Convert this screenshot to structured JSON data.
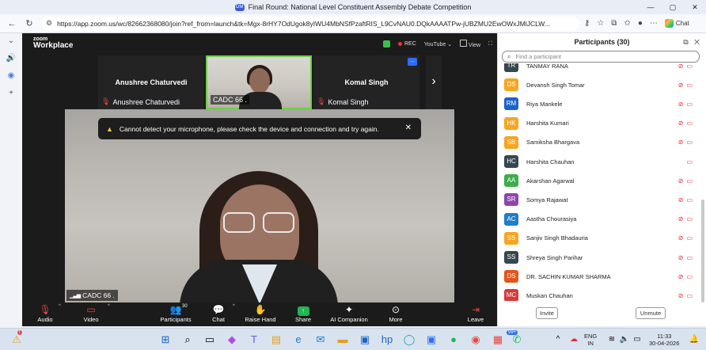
{
  "browser": {
    "tab_title": "Final Round:  National Level Constituent Assembly Debate Competition",
    "tab_logo": "DM",
    "url": "https://app.zoom.us/wc/82662368080/join?ref_from=launch&tk=Mgx-8rHY7OdUgok8yIWU4MbNSfPzaftRIS_L9CvNAU0.DQkAAAATPw-jUBZMU2EwOWxJMlJCLW...",
    "chat_label": "Chat"
  },
  "zoom": {
    "logo_line1": "zoom",
    "logo_line2": "Workplace",
    "rec_label": "REC",
    "youtube_label": "YouTube",
    "view_label": "View",
    "tiles": [
      {
        "big_name": "Anushree Chaturvedi",
        "label": "Anushree Chaturvedi"
      },
      {
        "big_name": "",
        "label": "CADC 66 ."
      },
      {
        "big_name": "Komal Singh",
        "label": "Komal Singh"
      }
    ],
    "more_label": "...",
    "toast": "Cannot detect your microphone, please check the device and connection and try again.",
    "main_label": "CADC 66 .",
    "toolbar": {
      "audio": "Audio",
      "video": "Video",
      "participants": "Participants",
      "participants_count": "30",
      "chat": "Chat",
      "raise_hand": "Raise Hand",
      "share": "Share",
      "ai_companion": "AI Companion",
      "more": "More",
      "leave": "Leave"
    }
  },
  "participants": {
    "title": "Participants (30)",
    "search_placeholder": "Find a participant",
    "list": [
      {
        "initials": "TR",
        "name": "TANMAY RANA",
        "color": "#37474f",
        "icons": "🎤📷"
      },
      {
        "initials": "DS",
        "name": "Devansh Singh Tomar",
        "color": "#f5a623",
        "icons": "🎤📷"
      },
      {
        "initials": "RM",
        "name": "Riya Mankele",
        "color": "#1e63c6",
        "icons": "🎤📷"
      },
      {
        "initials": "HK",
        "name": "Harshita Kumari",
        "color": "#f5a623",
        "icons": "🎤📷"
      },
      {
        "initials": "SB",
        "name": "Samiksha Bhargava",
        "color": "#f5a623",
        "icons": "🎤📷"
      },
      {
        "initials": "HC",
        "name": "Harshita Chauhan",
        "color": "#37474f",
        "icons": "📷"
      },
      {
        "initials": "AA",
        "name": "Akarshan Agarwal",
        "color": "#3cae4a",
        "icons": "🎤📷"
      },
      {
        "initials": "SR",
        "name": "Somya Rajawat",
        "color": "#8e44ad",
        "icons": "🎤📷"
      },
      {
        "initials": "AC",
        "name": "Aastha Chourasiya",
        "color": "#1e7fc6",
        "icons": "🎤📷"
      },
      {
        "initials": "SS",
        "name": "Sanjiv Singh Bhadauria",
        "color": "#f5a623",
        "icons": "🎤📷"
      },
      {
        "initials": "SS",
        "name": "Shreya Singh Parihar",
        "color": "#37474f",
        "icons": "🎤📷"
      },
      {
        "initials": "DS",
        "name": "DR. SACHIN KUMAR SHARMA",
        "color": "#e0561e",
        "icons": "🎤📷"
      },
      {
        "initials": "MC",
        "name": "Muskan Chauhan",
        "color": "#d63a3a",
        "icons": "🎤📷"
      }
    ],
    "invite": "Invite",
    "unmute": "Unmute"
  },
  "taskbar": {
    "lang1": "ENG",
    "lang2": "IN",
    "time": "11:33",
    "date": "30-04-2026",
    "notif_count": "99+"
  }
}
